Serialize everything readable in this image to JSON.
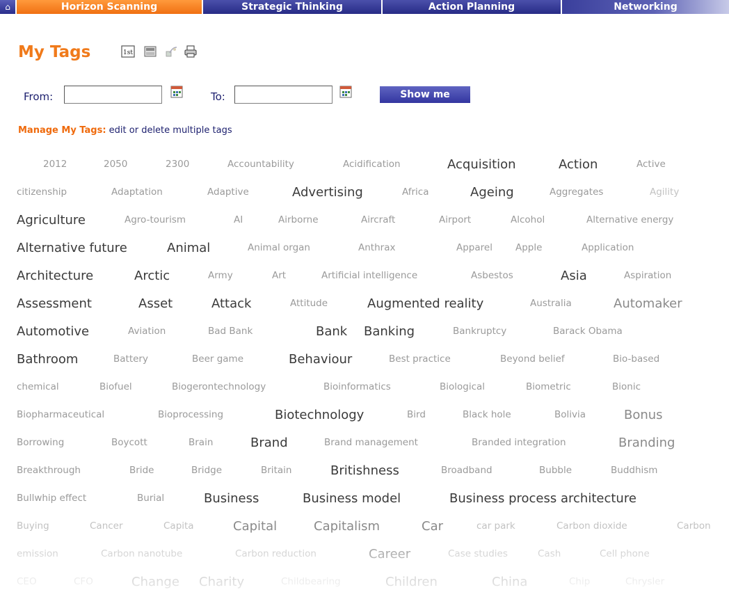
{
  "nav": {
    "tabs": [
      {
        "label": "Horizon Scanning",
        "active": true
      },
      {
        "label": "Strategic Thinking",
        "active": false
      },
      {
        "label": "Action Planning",
        "active": false
      },
      {
        "label": "Networking",
        "active": false
      }
    ]
  },
  "page": {
    "title": "My Tags",
    "icons": [
      "list-icon",
      "folder-icon",
      "share-icon",
      "print-icon"
    ]
  },
  "filter": {
    "from_label": "From:",
    "to_label": "To:",
    "from_value": "",
    "to_value": "",
    "button_label": "Show me"
  },
  "manage": {
    "label": "Manage My Tags:",
    "link": "edit or delete multiple tags"
  },
  "colors": {
    "accent_orange": "#f07012",
    "nav_blue": "#272b86",
    "button_blue": "#4347ad"
  },
  "tag_rows": [
    [
      "2012",
      "2050",
      "2300",
      "Accountability",
      "Acidification",
      "Acquisition",
      "Action",
      "Active"
    ],
    [
      "citizenship",
      "Adaptation",
      "Adaptive",
      "Advertising",
      "Africa",
      "Ageing",
      "Aggregates",
      "Agility"
    ],
    [
      "Agriculture",
      "Agro-tourism",
      "AI",
      "Airborne",
      "Aircraft",
      "Airport",
      "Alcohol",
      "Alternative energy"
    ],
    [
      "Alternative future",
      "Animal",
      "Animal organ",
      "Anthrax",
      "Apparel",
      "Apple",
      "Application"
    ],
    [
      "Architecture",
      "Arctic",
      "Army",
      "Art",
      "Artificial intelligence",
      "Asbestos",
      "Asia",
      "Aspiration"
    ],
    [
      "Assessment",
      "Asset",
      "Attack",
      "Attitude",
      "Augmented reality",
      "Australia",
      "Automaker"
    ],
    [
      "Automotive",
      "Aviation",
      "Bad Bank",
      "Bank",
      "Banking",
      "Bankruptcy",
      "Barack Obama"
    ],
    [
      "Bathroom",
      "Battery",
      "Beer game",
      "Behaviour",
      "Best practice",
      "Beyond belief",
      "Bio-based"
    ],
    [
      "chemical",
      "Biofuel",
      "Biogerontechnology",
      "Bioinformatics",
      "Biological",
      "Biometric",
      "Bionic"
    ],
    [
      "Biopharmaceutical",
      "Bioprocessing",
      "Biotechnology",
      "Bird",
      "Black hole",
      "Bolivia",
      "Bonus"
    ],
    [
      "Borrowing",
      "Boycott",
      "Brain",
      "Brand",
      "Brand management",
      "Branded integration",
      "Branding"
    ],
    [
      "Breakthrough",
      "Bride",
      "Bridge",
      "Britain",
      "Britishness",
      "Broadband",
      "Bubble",
      "Buddhism"
    ],
    [
      "Bullwhip effect",
      "Burial",
      "Business",
      "Business model",
      "Business process architecture"
    ],
    [
      "Buying",
      "Cancer",
      "Capita",
      "Capital",
      "Capitalism",
      "Car",
      "car park",
      "Carbon dioxide",
      "Carbon"
    ],
    [
      "emission",
      "Carbon nanotube",
      "Carbon reduction",
      "Career",
      "Case studies",
      "Cash",
      "Cell phone"
    ],
    [
      "CEO",
      "CFO",
      "Change",
      "Charity",
      "Childbearing",
      "Children",
      "China",
      "Chip",
      "Chrysler"
    ]
  ]
}
